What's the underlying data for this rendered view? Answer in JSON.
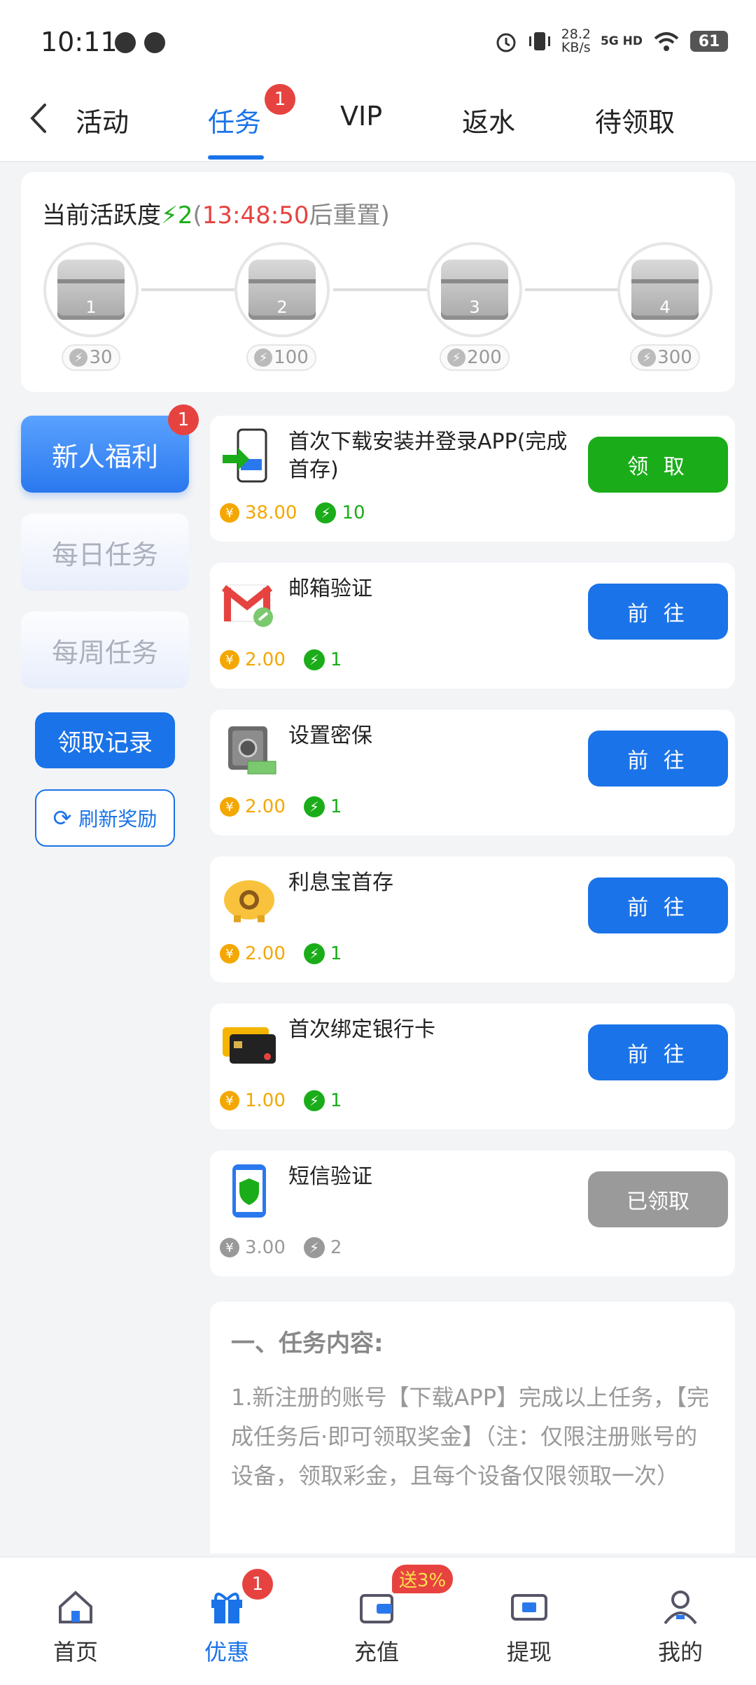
{
  "status_bar": {
    "time": "10:11",
    "net_speed_value": "28.2",
    "net_speed_unit": "KB/s",
    "network": "5G HD",
    "battery": "61"
  },
  "tabs": [
    {
      "label": "活动"
    },
    {
      "label": "任务",
      "badge": "1",
      "active": true
    },
    {
      "label": "VIP"
    },
    {
      "label": "返水"
    },
    {
      "label": "待领取"
    }
  ],
  "activity": {
    "title": "当前活跃度",
    "level": "2",
    "countdown": "13:48:50",
    "reset_suffix": "后重置",
    "paren_open": "(",
    "paren_close": ")",
    "chests": [
      {
        "num": "1",
        "points": "30"
      },
      {
        "num": "2",
        "points": "100"
      },
      {
        "num": "3",
        "points": "200"
      },
      {
        "num": "4",
        "points": "300"
      }
    ]
  },
  "categories": [
    {
      "label": "新人福利",
      "badge": "1",
      "active": true
    },
    {
      "label": "每日任务"
    },
    {
      "label": "每周任务"
    }
  ],
  "record_button": "领取记录",
  "refresh_button": "刷新奖励",
  "tasks": [
    {
      "name": "首次下载安装并登录APP(完成首存)",
      "button": "领 取",
      "amount": "38.00",
      "points": "10",
      "state": "claimable",
      "icon": "app-download-icon"
    },
    {
      "name": "邮箱验证",
      "button": "前 往",
      "amount": "2.00",
      "points": "1",
      "state": "go",
      "icon": "gmail-link-icon"
    },
    {
      "name": "设置密保",
      "button": "前 往",
      "amount": "2.00",
      "points": "1",
      "state": "go",
      "icon": "safe-icon"
    },
    {
      "name": "利息宝首存",
      "button": "前 往",
      "amount": "2.00",
      "points": "1",
      "state": "go",
      "icon": "piggy-bank-icon"
    },
    {
      "name": "首次绑定银行卡",
      "button": "前 往",
      "amount": "1.00",
      "points": "1",
      "state": "go",
      "icon": "bank-card-icon"
    },
    {
      "name": "短信验证",
      "button": "已领取",
      "amount": "3.00",
      "points": "2",
      "state": "claimed",
      "icon": "phone-shield-icon"
    }
  ],
  "content": {
    "title": "一、任务内容:",
    "text": "1.新注册的账号【下载APP】完成以上任务，【完成任务后·即可领取奖金】（注：仅限注册账号的设备，领取彩金，且每个设备仅限领取一次）"
  },
  "bottom_nav": [
    {
      "label": "首页",
      "icon": "home-icon"
    },
    {
      "label": "优惠",
      "icon": "gift-icon",
      "badge": "1",
      "active": true
    },
    {
      "label": "充值",
      "icon": "wallet-icon",
      "promo": "送3%"
    },
    {
      "label": "提现",
      "icon": "withdraw-icon"
    },
    {
      "label": "我的",
      "icon": "user-icon"
    }
  ],
  "colors": {
    "accent": "#1a73e8",
    "green": "#1aad19",
    "red": "#e64340",
    "gold": "#f4a700"
  }
}
